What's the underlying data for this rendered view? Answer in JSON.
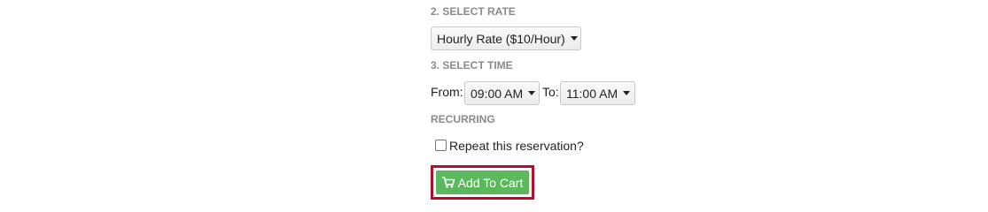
{
  "rate_section": {
    "heading": "2. SELECT RATE",
    "selected_rate": "Hourly Rate ($10/Hour)"
  },
  "time_section": {
    "heading": "3. SELECT TIME",
    "from_label": "From:",
    "from_value": "09:00 AM",
    "to_label": "To:",
    "to_value": "11:00 AM"
  },
  "recurring_section": {
    "heading": "RECURRING",
    "repeat_label": "Repeat this reservation?",
    "repeat_checked": false
  },
  "cart": {
    "button_label": "Add To Cart",
    "button_color": "#5cb85c",
    "highlight_color": "#b0102a",
    "icon": "cart-plus-icon"
  }
}
